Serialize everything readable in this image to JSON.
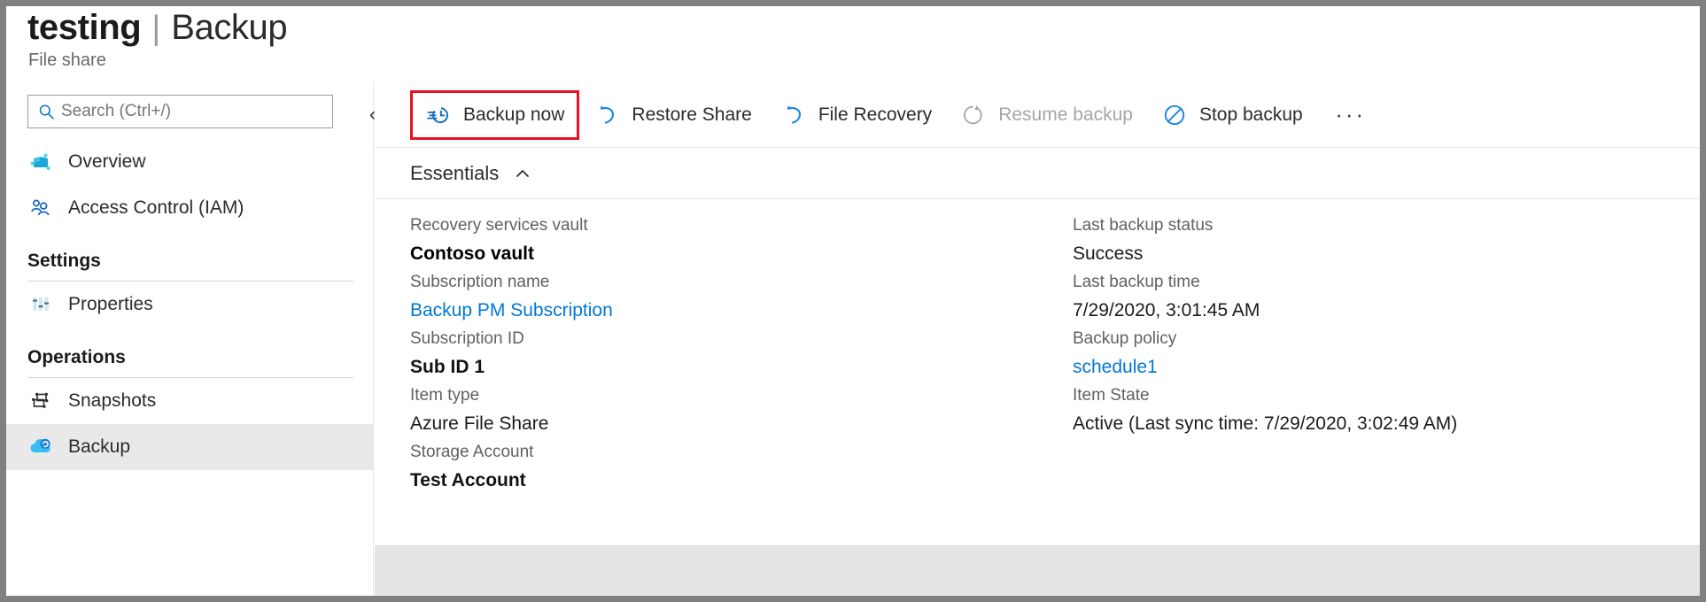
{
  "header": {
    "resource_name": "testing",
    "separator": "|",
    "blade_name": "Backup",
    "subtitle": "File share"
  },
  "sidebar": {
    "search": {
      "placeholder": "Search (Ctrl+/)",
      "value": "",
      "icon": "search-icon"
    },
    "collapse_button": {
      "glyph": "«",
      "name": "collapse-sidebar-button"
    },
    "items": [
      {
        "label": "Overview",
        "icon": "overview-icon",
        "selected": false
      },
      {
        "label": "Access Control (IAM)",
        "icon": "access-control-icon",
        "selected": false
      }
    ],
    "sections": [
      {
        "title": "Settings",
        "items": [
          {
            "label": "Properties",
            "icon": "properties-icon",
            "selected": false
          }
        ]
      },
      {
        "title": "Operations",
        "items": [
          {
            "label": "Snapshots",
            "icon": "snapshots-icon",
            "selected": false
          },
          {
            "label": "Backup",
            "icon": "backup-cloud-icon",
            "selected": true
          }
        ]
      }
    ]
  },
  "command_bar": {
    "buttons": [
      {
        "label": "Backup now",
        "icon": "backup-now-clock-icon",
        "disabled": false,
        "highlighted": true
      },
      {
        "label": "Restore Share",
        "icon": "restore-arrow-icon",
        "disabled": false,
        "highlighted": false
      },
      {
        "label": "File Recovery",
        "icon": "file-recovery-arrow-icon",
        "disabled": false,
        "highlighted": false
      },
      {
        "label": "Resume backup",
        "icon": "resume-circle-arrow-icon",
        "disabled": true,
        "highlighted": false
      },
      {
        "label": "Stop backup",
        "icon": "stop-backup-circle-slash-icon",
        "disabled": false,
        "highlighted": false
      }
    ],
    "more_button_glyph": "···"
  },
  "essentials": {
    "title": "Essentials",
    "chevron": "chevron-up-icon",
    "left_column": [
      {
        "label": "Recovery services vault",
        "value": "Contoso vault",
        "style": "bold"
      },
      {
        "label": "Subscription name",
        "value": "Backup PM Subscription",
        "style": "link"
      },
      {
        "label": "Subscription ID",
        "value": "Sub ID 1",
        "style": "semibold"
      },
      {
        "label": "Item type",
        "value": "Azure File Share",
        "style": "normal"
      },
      {
        "label": "Storage Account",
        "value": "Test Account",
        "style": "semibold"
      }
    ],
    "right_column": [
      {
        "label": "Last backup status",
        "value": "Success",
        "style": "normal"
      },
      {
        "label": "Last backup time",
        "value": "7/29/2020, 3:01:45 AM",
        "style": "normal"
      },
      {
        "label": "Backup policy",
        "value": "schedule1",
        "style": "link"
      },
      {
        "label": "Item State",
        "value": "Active (Last sync time: 7/29/2020, 3:02:49 AM)",
        "style": "normal"
      }
    ]
  },
  "colors": {
    "azure_blue": "#0078d4",
    "highlight_red": "#e81123",
    "disabled_grey": "#a6a6a6",
    "selected_row": "#e9e9e9"
  }
}
